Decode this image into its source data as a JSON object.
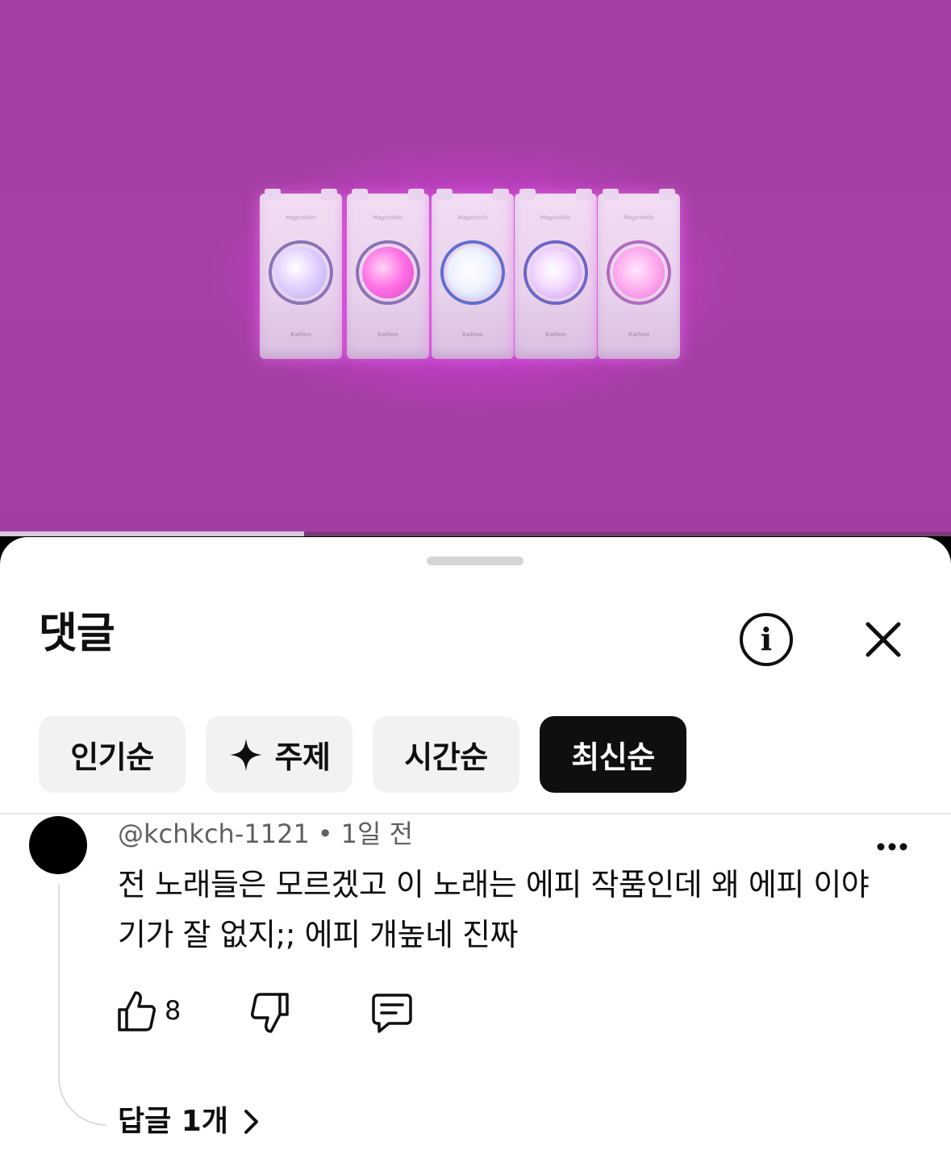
{
  "video": {
    "progress_fraction": 0.32,
    "background_color": "#a43ea4",
    "phones": [
      {
        "brand": "MagicHolic",
        "foot": "Kaiton"
      },
      {
        "brand": "MagicHolic",
        "foot": "Kaiton"
      },
      {
        "brand": "MagicHolic",
        "foot": "Kaiton"
      },
      {
        "brand": "MagicHolic",
        "foot": "Kaiton"
      },
      {
        "brand": "MagicHolic",
        "foot": "Kaiton"
      }
    ]
  },
  "sheet": {
    "title": "댓글",
    "info_icon": "info-icon",
    "close_icon": "close-icon"
  },
  "filters": [
    {
      "label": "인기순",
      "active": false
    },
    {
      "label": "주제",
      "active": false,
      "icon": "sparkle-icon"
    },
    {
      "label": "시간순",
      "active": false
    },
    {
      "label": "최신순",
      "active": true
    }
  ],
  "comment": {
    "author": "@kchkch-1121",
    "separator": "•",
    "time": "1일 전",
    "text": "전 노래들은 모르겠고 이 노래는 에피 작품인데 왜 에피 이야기가 잘 없지;; 에피 개높네 진짜",
    "like_count": "8",
    "replies_label": "답글 1개"
  },
  "colors": {
    "active_chip": "#0f0f0f",
    "chip": "#f2f2f2",
    "meta_text": "#606060"
  }
}
